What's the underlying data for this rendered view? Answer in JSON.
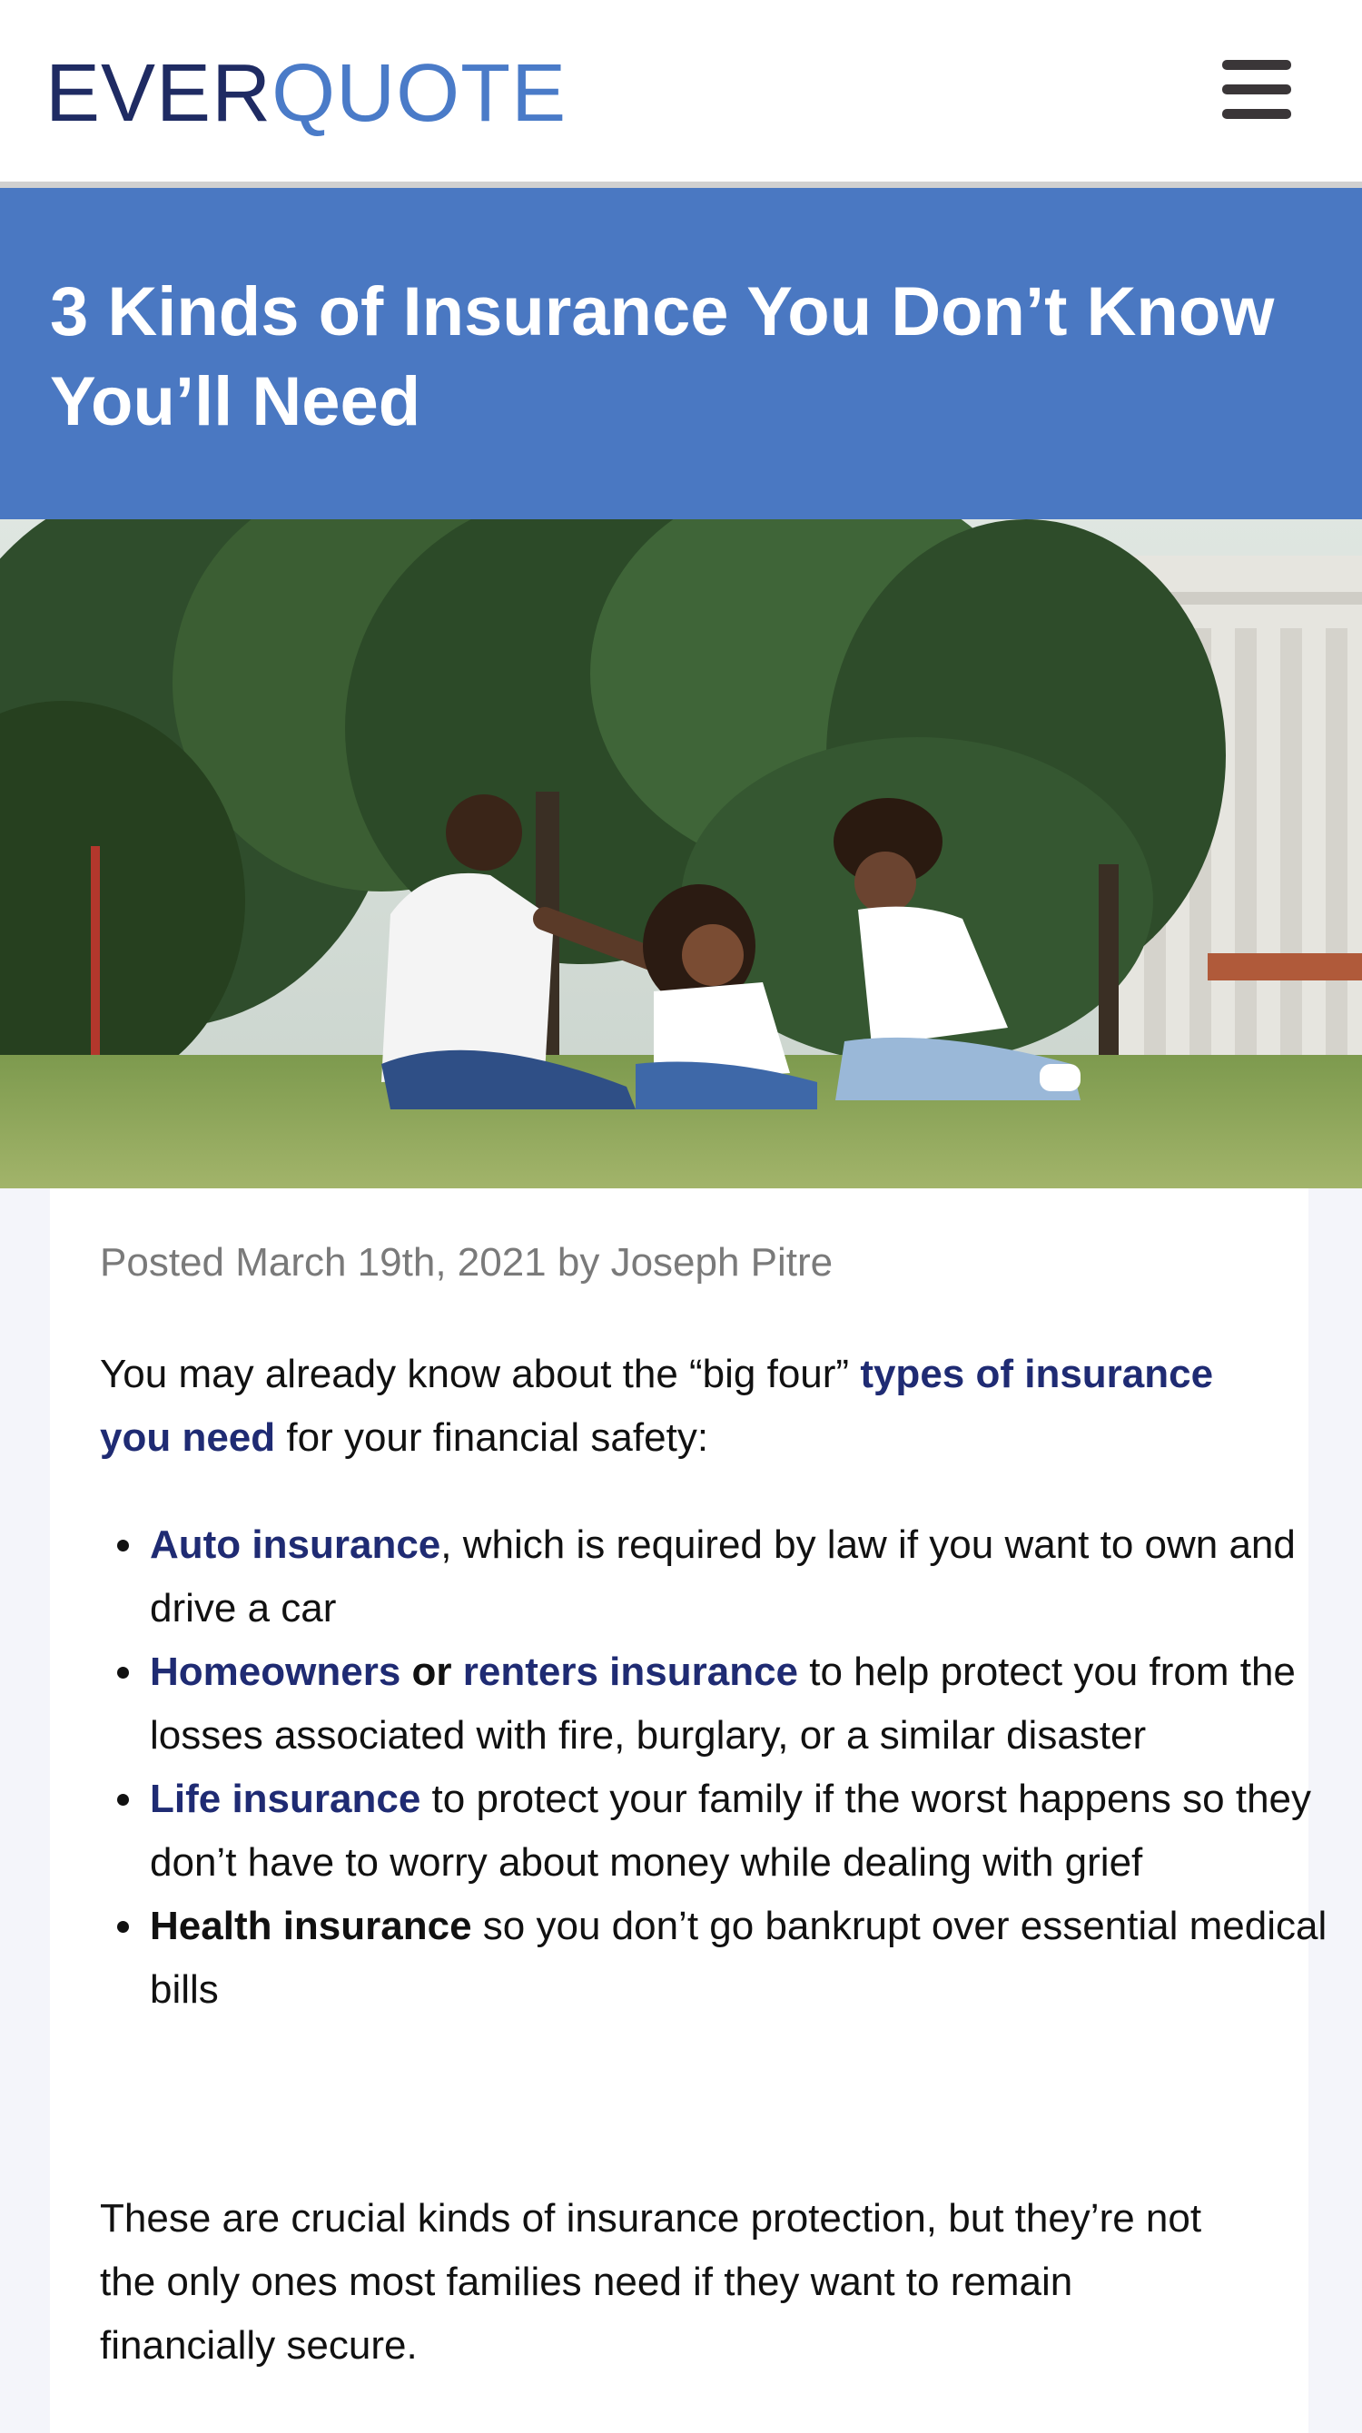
{
  "header": {
    "logo_part1": "EVER",
    "logo_part2": "QUOTE",
    "menu_icon": "hamburger-menu-icon"
  },
  "hero": {
    "title": "3 Kinds of Insurance You Don’t Know You’ll Need"
  },
  "article": {
    "meta": "Posted March 19th, 2021 by Joseph Pitre",
    "intro_before": "You may already know about the “big four” ",
    "intro_link": "types of insurance you need",
    "intro_after": " for your financial safety:",
    "bullets": [
      {
        "link": "Auto insurance",
        "text": ", which is required by law if you want to own and drive a car"
      },
      {
        "link": "Homeowners",
        "mid": " or ",
        "link2": "renters insurance",
        "text": " to help protect you from the losses associated with fire, burglary, or a similar disaster"
      },
      {
        "link": "Life insurance",
        "text": " to protect your family if the worst happens so they don’t have to worry about money while dealing with grief"
      },
      {
        "bold": "Health insurance",
        "text": " so you don’t go bankrupt over essential medical bills"
      }
    ],
    "closing": "These are crucial kinds of insurance protection, but they’re not the only ones most families need if they want to remain financially secure."
  },
  "colors": {
    "brand_dark": "#1f2b63",
    "brand_light": "#4a7bc8",
    "hero_band": "#4a78c2",
    "link": "#1f2b73"
  }
}
